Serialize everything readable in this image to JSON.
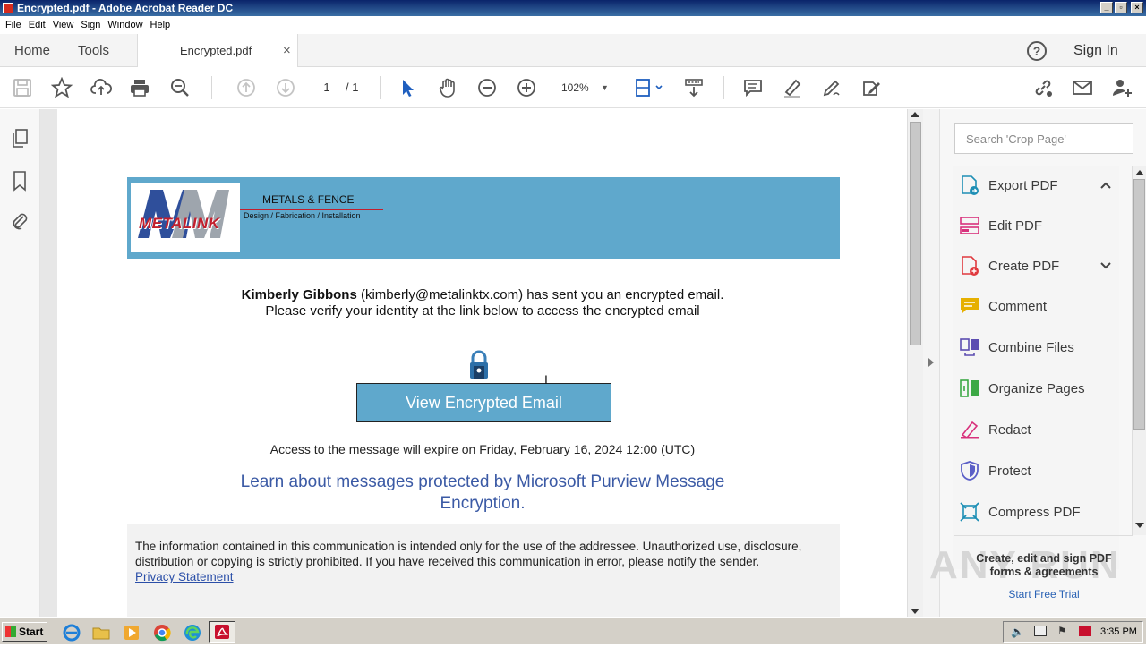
{
  "window": {
    "title": "Encrypted.pdf - Adobe Acrobat Reader DC"
  },
  "menu": [
    "File",
    "Edit",
    "View",
    "Sign",
    "Window",
    "Help"
  ],
  "tabs": {
    "home": "Home",
    "tools": "Tools",
    "document": "Encrypted.pdf",
    "close": "×",
    "signin": "Sign In",
    "help": "?"
  },
  "toolbar": {
    "page_current": "1",
    "page_total": "/ 1",
    "zoom": "102%"
  },
  "search": {
    "placeholder": "Search 'Crop Page'"
  },
  "tools_panel": {
    "items": [
      {
        "label": "Export PDF",
        "icon": "export-pdf-icon",
        "color": "#1e8fb5"
      },
      {
        "label": "Edit PDF",
        "icon": "edit-pdf-icon",
        "color": "#d8317c"
      },
      {
        "label": "Create PDF",
        "icon": "create-pdf-icon",
        "color": "#e0393e"
      },
      {
        "label": "Comment",
        "icon": "comment-icon",
        "color": "#e6b000"
      },
      {
        "label": "Combine Files",
        "icon": "combine-files-icon",
        "color": "#5c4db1"
      },
      {
        "label": "Organize Pages",
        "icon": "organize-pages-icon",
        "color": "#3ca845"
      },
      {
        "label": "Redact",
        "icon": "redact-icon",
        "color": "#d8317c"
      },
      {
        "label": "Protect",
        "icon": "protect-icon",
        "color": "#5b5fc7"
      },
      {
        "label": "Compress PDF",
        "icon": "compress-pdf-icon",
        "color": "#1e8fb5"
      }
    ],
    "promo_line1": "Create, edit and sign PDF",
    "promo_line2": "forms & agreements",
    "promo_link": "Start Free Trial"
  },
  "document": {
    "banner": {
      "company": "METALS & FENCE",
      "tagline": "Design / Fabrication / Installation",
      "logo_text": "METALINK",
      "color": "#5fa8cc"
    },
    "sender_name": "Kimberly Gibbons",
    "sender_rest": " (kimberly@metalinktx.com) has sent you an encrypted email.",
    "verify_line": "Please verify your identity at the link below to access the encrypted email",
    "button_label": "View Encrypted Email",
    "expiry": "Access to the message will expire on Friday, February 16, 2024 12:00 (UTC)",
    "learn_line1": "Learn about messages protected by Microsoft Purview Message",
    "learn_line2": "Encryption.",
    "disclaimer_line1": "The information contained in this communication is intended only for the use of the addressee. Unauthorized use, disclosure,",
    "disclaimer_line2": "distribution or copying is strictly prohibited. If you have received this communication in error, please notify the sender.",
    "privacy_link": "Privacy Statement"
  },
  "taskbar": {
    "start": "Start",
    "clock": "3:35 PM"
  },
  "watermark": "ANY RUN"
}
